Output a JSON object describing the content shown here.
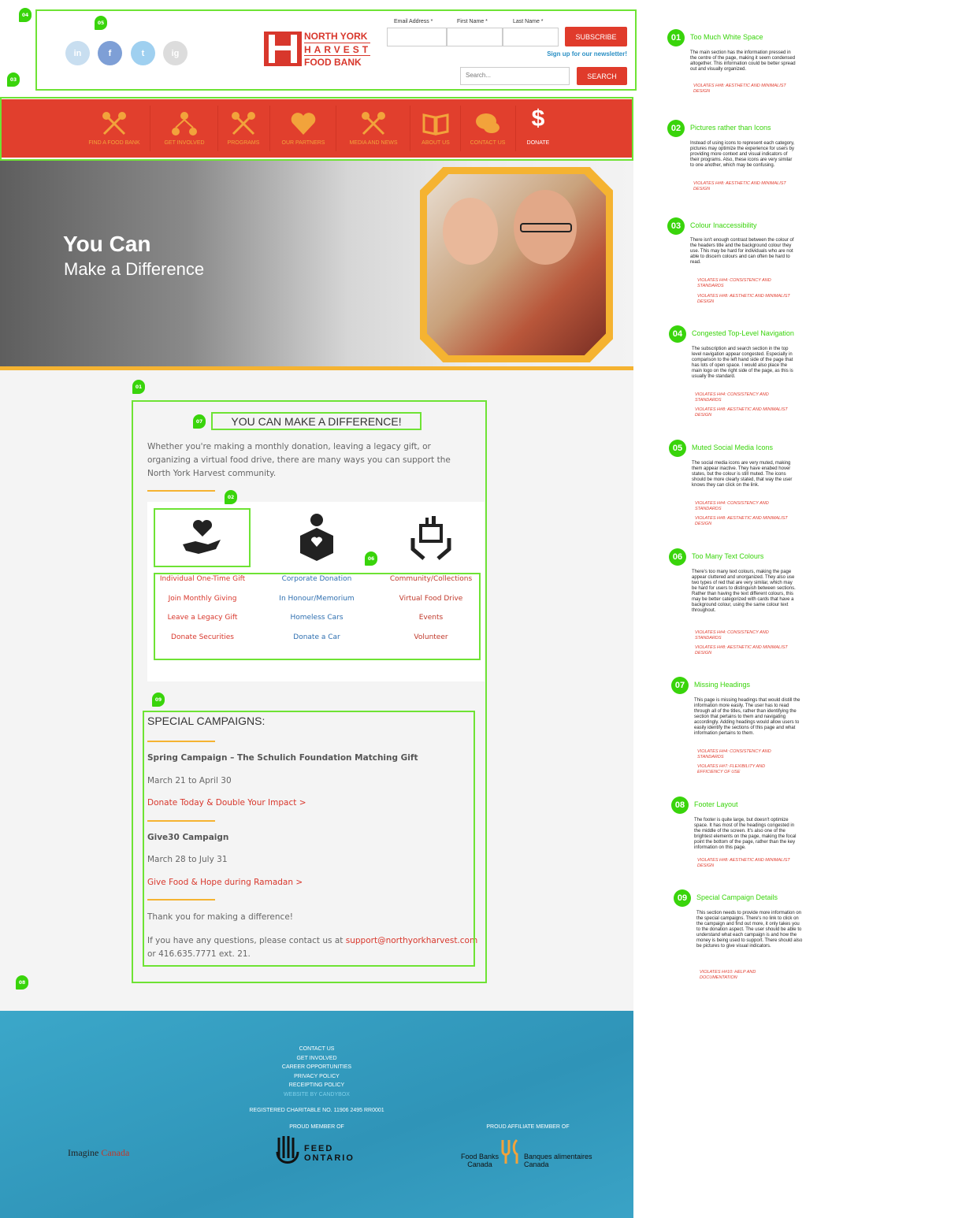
{
  "header": {
    "social": [
      "in",
      "f",
      "t",
      "ig"
    ],
    "logo": {
      "line1": "NORTH YORK",
      "line2": "HARVEST",
      "line3": "FOOD BANK"
    },
    "form": {
      "email_label": "Email Address *",
      "first_label": "First Name *",
      "last_label": "Last Name *",
      "subscribe": "SUBSCRIBE",
      "signup": "Sign up for our newsletter!",
      "search_placeholder": "Search...",
      "search_button": "SEARCH"
    }
  },
  "nav": [
    "FIND A FOOD BANK",
    "GET INVOLVED",
    "PROGRAMS",
    "OUR PARTNERS",
    "MEDIA AND NEWS",
    "ABOUT US",
    "CONTACT US",
    "DONATE"
  ],
  "hero": {
    "title": "You Can",
    "subtitle": "Make a Difference"
  },
  "main": {
    "heading": "YOU CAN MAKE A DIFFERENCE!",
    "intro": "Whether you're making a monthly donation, leaving a legacy gift, or organizing a virtual food drive, there are many ways you can support the North York Harvest community.",
    "columns": [
      [
        "Individual One-Time Gift",
        "Join Monthly Giving",
        "Leave a Legacy Gift",
        "Donate Securities"
      ],
      [
        "Corporate Donation",
        "In Honour/Memorium",
        "Homeless Cars",
        "Donate a Car"
      ],
      [
        "Community/Collections",
        "Virtual Food Drive",
        "Events",
        "Volunteer"
      ]
    ],
    "campaigns_heading": "SPECIAL CAMPAIGNS:",
    "c1_title": "Spring Campaign – The Schulich Foundation Matching Gift",
    "c1_dates": "March 21 to April 30",
    "c1_link": "Donate Today & Double Your Impact >",
    "c2_title": "Give30 Campaign",
    "c2_dates": "March 28 to July 31",
    "c2_link": "Give Food & Hope during Ramadan >",
    "thanks": "Thank you for making a difference!",
    "contact_pre": "If you have any questions, please contact us at",
    "contact_email": "support@northyorkharvest.com",
    "contact_post": "or",
    "contact_phone": "416.635.7771 ext. 21."
  },
  "footer": {
    "links": [
      "CONTACT US",
      "GET INVOLVED",
      "CAREER OPPORTUNITIES",
      "PRIVACY POLICY",
      "RECEIPTING POLICY",
      "WEBSITE BY CANDYBOX"
    ],
    "charity": "REGISTERED CHARITABLE NO. 11906 2495 RR0001",
    "member": "PROUD MEMBER OF",
    "affiliate": "PROUD AFFILIATE MEMBER OF",
    "imagine": "Imagine",
    "imagine2": "Canada",
    "feed1": "FEED",
    "feed2": "ONTARIO",
    "fbc1": "Food Banks",
    "fbc2": "Canada",
    "bac1": "Banques alimentaires",
    "bac2": "Canada"
  },
  "pins": [
    "04",
    "05",
    "03",
    "01",
    "07",
    "02",
    "06",
    "09",
    "08"
  ],
  "annotations": [
    {
      "num": "01",
      "title": "Too Much White Space",
      "body": "The main section has the information pressed in the centre of the page, making it seem condensed altogether. This information could be better spread out and visually organized.",
      "v": [
        "VIOLATES H#8: AESTHETIC AND MINIMALIST DESIGN"
      ]
    },
    {
      "num": "02",
      "title": "Pictures rather than Icons",
      "body": "Instead of using icons to represent each category, pictures may optimize the experience for users by providing more context and visual indicators of their programs. Also, these icons are very similar to one another, which may be confusing.",
      "v": [
        "VIOLATES H#8: AESTHETIC AND MINIMALIST DESIGN"
      ]
    },
    {
      "num": "03",
      "title": "Colour Inaccessibility",
      "body": "There isn't enough contrast between the colour of the headers title and the background colour they use. This may be hard for individuals who are not able to discern colours and can often be hard to read.",
      "v": [
        "VIOLATES H#4: CONSISTENCY AND STANDARDS",
        "VIOLATES H#8: AESTHETIC AND MINIMALIST DESIGN"
      ]
    },
    {
      "num": "04",
      "title": "Congested Top-Level Navigation",
      "body": "The subscription and search section in the top level navigation appear congested. Especially in comparison to the left hand side of the page that has lots of open space. I would also place the main logo on the right side of the page, as this is usually the standard.",
      "v": [
        "VIOLATES H#4: CONSISTENCY AND STANDARDS",
        "VIOLATES H#8: AESTHETIC AND MINIMALIST DESIGN"
      ]
    },
    {
      "num": "05",
      "title": "Muted Social Media Icons",
      "body": "The social media icons are very muted, making them appear inactive. They have enabed hover states, but the colour is still muted. The icons should be more clearly stated, that way the user knows they can click on the link.",
      "v": [
        "VIOLATES H#4: CONSISTENCY AND STANDARDS",
        "VIOLATES H#8: AESTHETIC AND MINIMALIST DESIGN"
      ]
    },
    {
      "num": "06",
      "title": "Too Many Text Colours",
      "body": "There's too many text colours, making the page appear cluttered and unorganized. They also use two types of red that are very similar, which may be hard for users to distinguish between sections. Rather than having the text different colours, this may be better categorized with cards that have a background colour, using the same colour text throughout.",
      "v": [
        "VIOLATES H#4: CONSISTENCY AND STANDARDS",
        "VIOLATES H#8: AESTHETIC AND MINIMALIST DESIGN"
      ]
    },
    {
      "num": "07",
      "title": "Missing Headings",
      "body": "This page is missing headings that would distill the information more easily. The user has to read through all of the titles, rather than identifying the section that pertains to them and navigating accordingly. Adding headings would allow users to easily identify the sections of this page and what information pertains to them.",
      "v": [
        "VIOLATES H#4: CONSISTENCY AND STANDARDS",
        "VIOLATES H#7: FLEXIBILITY AND EFFICIENCY OF USE"
      ]
    },
    {
      "num": "08",
      "title": "Footer Layout",
      "body": "The footer is quite large, but doesn't optimize space. It has most of the headings congested in the middle of the screen. It's also one of the brightest elements on the page, making the focal point the bottom of the page, rather than the key information on this page.",
      "v": [
        "VIOLATES H#8: AESTHETIC AND MINIMALIST DESIGN"
      ]
    },
    {
      "num": "09",
      "title": "Special Campaign Details",
      "body": "This section needs to provide more information on the special campaigns. There's no link to click on the campaign and find out more, it only takes you to the donation aspect. The user should be able to understand what each campaign is and how the money is being used to support. There should also be pictures to give visual indicators.",
      "v": [
        "VIOLATES H#10: HELP AND DOCUMENTATION"
      ]
    }
  ]
}
